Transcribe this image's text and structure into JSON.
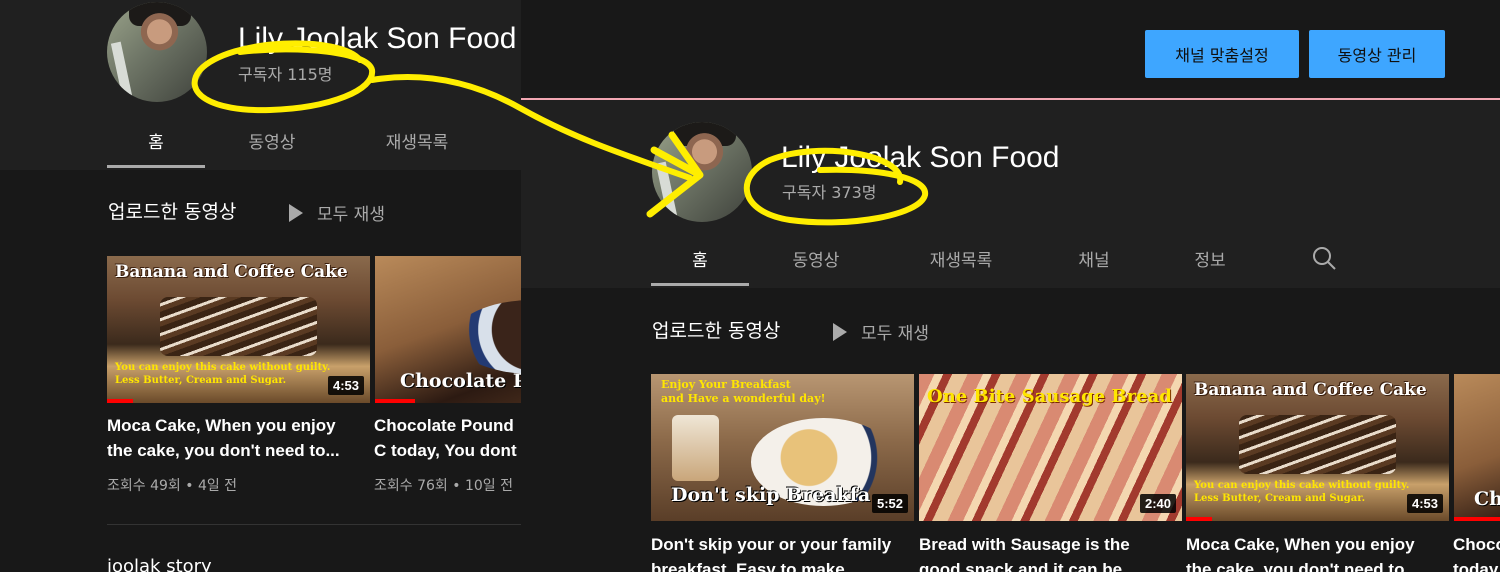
{
  "left_shot": {
    "channel_name": "Lily Joolak Son Food",
    "subscribers": "구독자 115명",
    "tabs": [
      {
        "label": "홈",
        "active": true
      },
      {
        "label": "동영상",
        "active": false
      },
      {
        "label": "재생목록",
        "active": false
      }
    ],
    "section_title": "업로드한 동영상",
    "play_all": "모두 재생",
    "videos": [
      {
        "thumb_caption_top": "Banana and Coffee Cake",
        "thumb_caption_bottom_1": "You can enjoy this cake without guilty.",
        "thumb_caption_bottom_2": "Less Butter, Cream and Sugar.",
        "duration": "4:53",
        "title": "Moca Cake, When you enjoy the cake, you don't need to...",
        "meta": "조회수 49회 • 4일 전"
      },
      {
        "thumb_caption_bottom": "Chocolate P",
        "title": "Chocolate Pound C today, You dont nee",
        "meta": "조회수 76회 • 10일 전"
      }
    ],
    "next_section_title": "joolak story"
  },
  "right_shot": {
    "buttons": {
      "customize": "채널 맞춤설정",
      "manage_videos": "동영상 관리"
    },
    "channel_name": "Lily Joolak Son Food",
    "subscribers": "구독자 373명",
    "tabs": [
      {
        "label": "홈",
        "active": true
      },
      {
        "label": "동영상",
        "active": false
      },
      {
        "label": "재생목록",
        "active": false
      },
      {
        "label": "채널",
        "active": false
      },
      {
        "label": "정보",
        "active": false
      }
    ],
    "section_title": "업로드한 동영상",
    "play_all": "모두 재생",
    "videos": [
      {
        "thumb_caption_top_1": "Enjoy Your Breakfast",
        "thumb_caption_top_2": "and Have a wonderful day!",
        "thumb_caption_bottom": "Don't skip Breakfa",
        "duration": "5:52",
        "title": "Don't skip your or your family breakfast. Easy to make"
      },
      {
        "thumb_caption_top": "One Bite Sausage Bread",
        "duration": "2:40",
        "title": "Bread with Sausage is the good snack and it can be"
      },
      {
        "thumb_caption_top": "Banana and Coffee Cake",
        "thumb_caption_bottom_1": "You can enjoy this cake without guilty.",
        "thumb_caption_bottom_2": "Less Butter, Cream and Sugar.",
        "duration": "4:53",
        "title": "Moca Cake, When you enjoy the cake, you don't need to"
      },
      {
        "thumb_caption_bottom": "Ch",
        "title": "Choco today"
      }
    ]
  },
  "annotation": {
    "color": "#ffee00"
  },
  "colors": {
    "background": "#181818",
    "header_band": "#202020",
    "button_blue": "#3ea6ff",
    "progress_red": "#ff0000",
    "divider_pink": "#f2a7b3"
  }
}
